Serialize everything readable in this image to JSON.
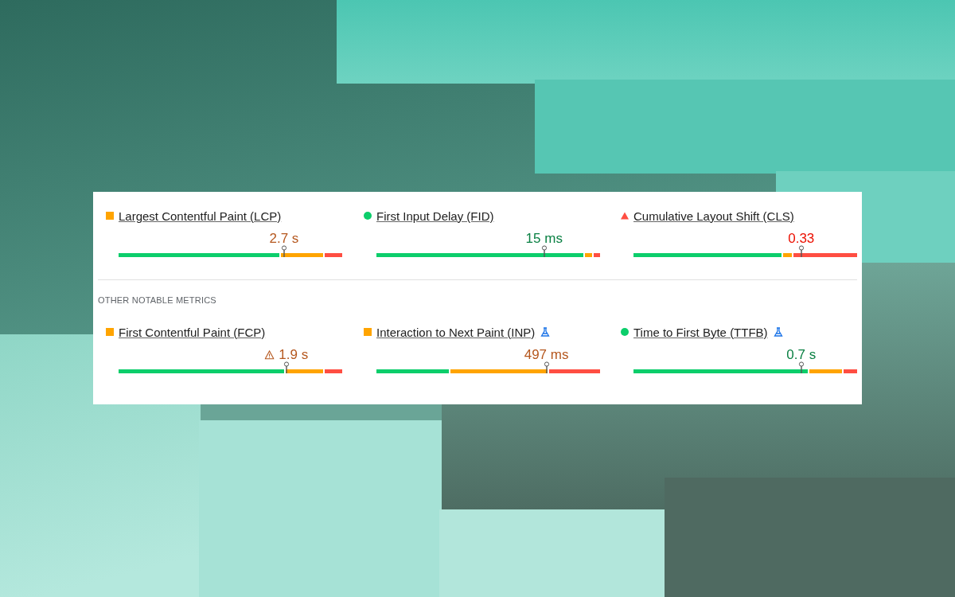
{
  "core_metrics": [
    {
      "label": "Largest Contentful Paint (LCP)",
      "kind": "needs",
      "experimental": false,
      "value": "2.7 s",
      "warning": false
    },
    {
      "label": "First Input Delay (FID)",
      "kind": "good",
      "experimental": false,
      "value": "15 ms",
      "warning": false
    },
    {
      "label": "Cumulative Layout Shift (CLS)",
      "kind": "poor",
      "experimental": false,
      "value": "0.33",
      "warning": false
    }
  ],
  "other_heading": "OTHER NOTABLE METRICS",
  "other_metrics": [
    {
      "label": "First Contentful Paint (FCP)",
      "kind": "needs",
      "experimental": false,
      "value": "1.9 s",
      "warning": true
    },
    {
      "label": "Interaction to Next Paint (INP)",
      "kind": "needs",
      "experimental": true,
      "value": "497 ms",
      "warning": false
    },
    {
      "label": "Time to First Byte (TTFB)",
      "kind": "good",
      "experimental": true,
      "value": "0.7 s",
      "warning": false
    }
  ]
}
